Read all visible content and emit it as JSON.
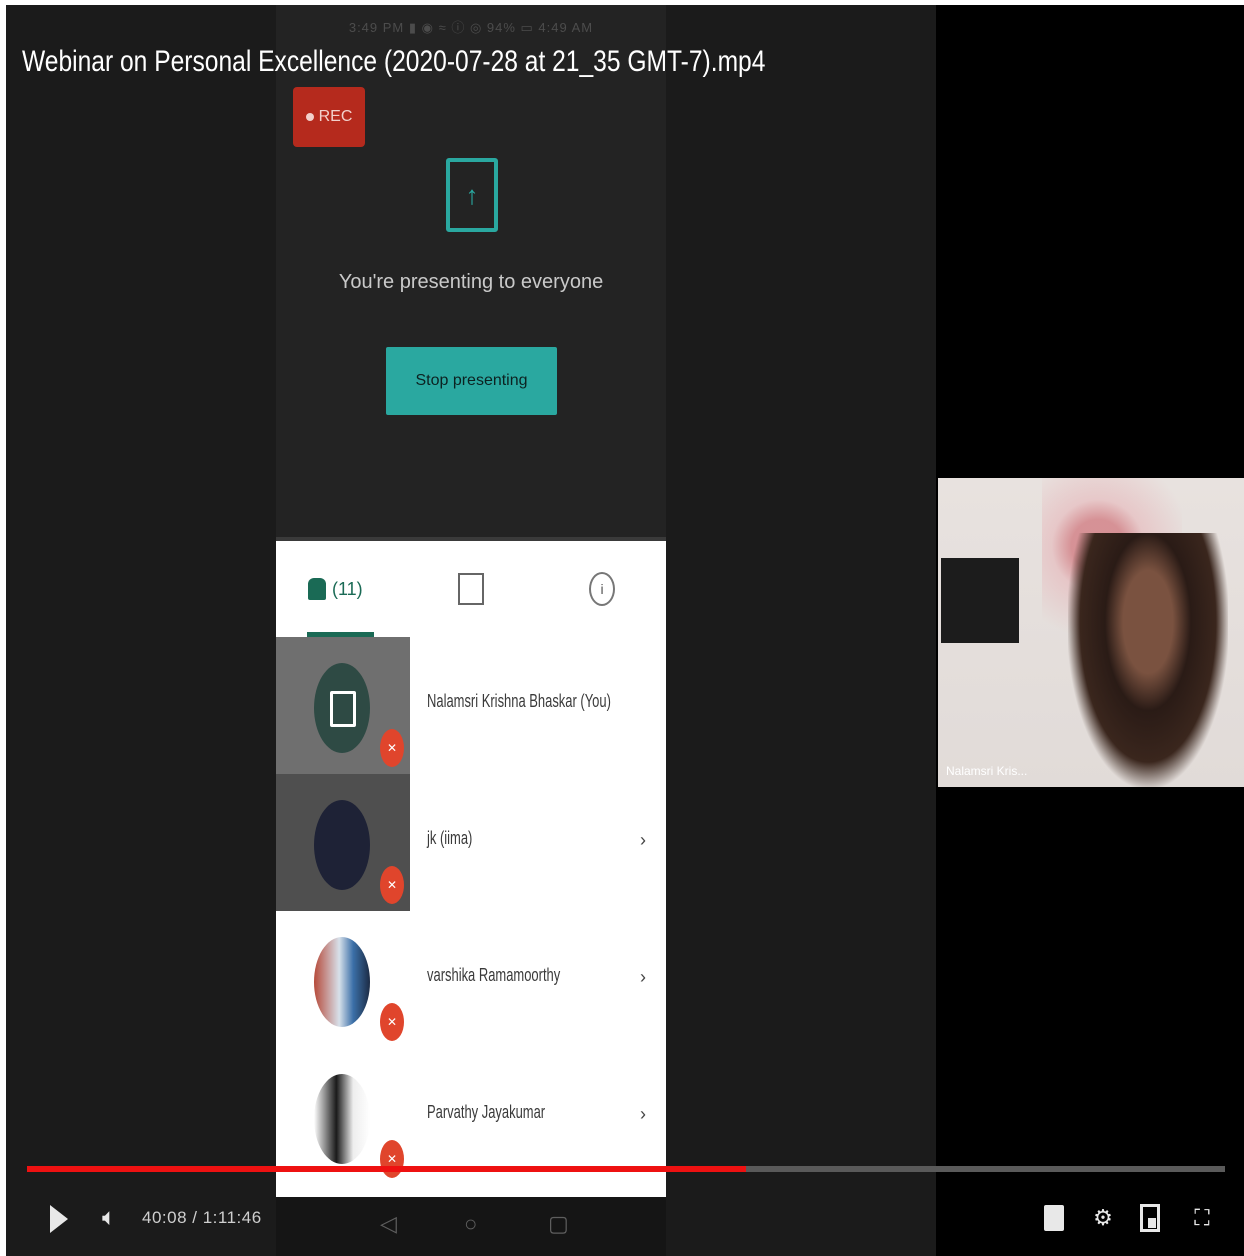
{
  "video": {
    "title": "Webinar on Personal Excellence (2020-07-28 at 21_35 GMT-7).mp4",
    "status_bar_text": "3:49 PM ▮ ◉ ≈        ⓘ ◎ 94% ▭ 4:49 AM"
  },
  "meeting": {
    "rec_label": "REC",
    "presenting_message": "You're presenting to everyone",
    "stop_button": "Stop presenting",
    "tabs": {
      "people_label": "(11)",
      "chat_icon": "chat-icon",
      "info_icon": "info-icon"
    },
    "participants": [
      {
        "name": "Nalamsri Krishna Bhaskar (You)",
        "chevron": ""
      },
      {
        "name": "jk (iima)",
        "chevron": "›"
      },
      {
        "name": "varshika Ramamoorthy",
        "chevron": "›"
      },
      {
        "name": "Parvathy Jayakumar",
        "chevron": "›"
      }
    ],
    "self_view_name": "Nalamsri Kris..."
  },
  "player": {
    "time": "40:08 / 1:11:46",
    "progress": 0.6,
    "accent_color": "#ee1111"
  }
}
